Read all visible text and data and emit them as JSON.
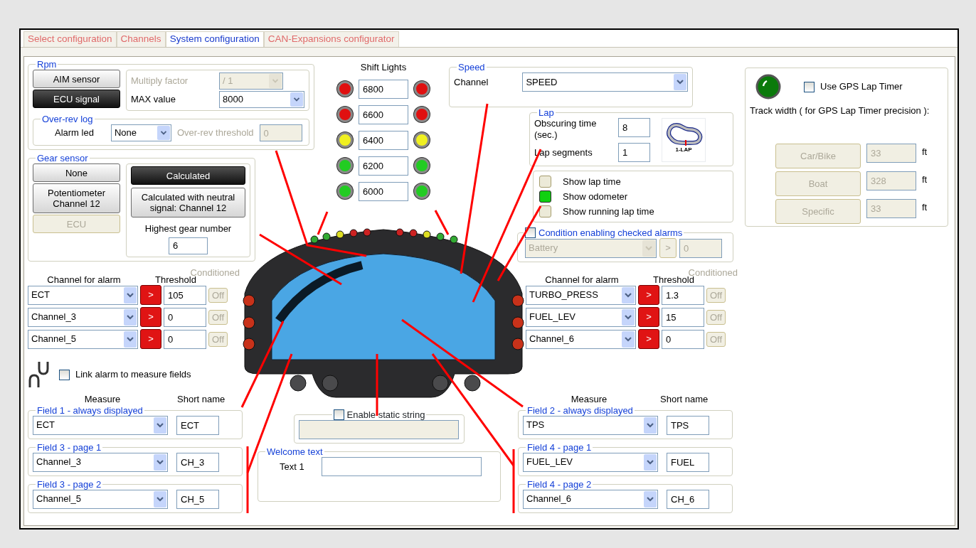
{
  "tabs": [
    {
      "label": "Select configuration",
      "selected": false
    },
    {
      "label": "Channels",
      "selected": false
    },
    {
      "label": "System configuration",
      "selected": true
    },
    {
      "label": "CAN-Expansions configurator",
      "selected": false
    }
  ],
  "rpm": {
    "title": "Rpm",
    "sources": [
      {
        "label": "AIM sensor",
        "selected": false
      },
      {
        "label": "ECU signal",
        "selected": true
      }
    ],
    "multiply_factor": {
      "label": "Multiply factor",
      "value": "/ 1",
      "disabled": true
    },
    "max_value": {
      "label": "MAX value",
      "value": "8000",
      "disabled": false
    }
  },
  "over_rev_log": {
    "title": "Over-rev log",
    "alarm_led": {
      "label": "Alarm led",
      "value": "None"
    },
    "threshold": {
      "label": "Over-rev threshold",
      "value": "0",
      "disabled": true
    }
  },
  "gear_sensor": {
    "title": "Gear sensor",
    "sources": [
      {
        "label": "None",
        "selected": false,
        "disabled": false
      },
      {
        "label": "Potentiometer Channel 12",
        "selected": false,
        "disabled": false
      },
      {
        "label": "ECU",
        "selected": false,
        "disabled": true
      }
    ],
    "modes": [
      {
        "label": "Calculated",
        "selected": true
      },
      {
        "label": "Calculated with neutral signal:  Channel 12",
        "selected": false
      }
    ],
    "highest_gear": {
      "label": "Highest gear number",
      "value": "6"
    }
  },
  "shift_lights": {
    "title": "Shift Lights",
    "rows": [
      {
        "value": "6800",
        "color": "#e01010"
      },
      {
        "value": "6600",
        "color": "#e01010"
      },
      {
        "value": "6400",
        "color": "#f0f020"
      },
      {
        "value": "6200",
        "color": "#22cc22"
      },
      {
        "value": "6000",
        "color": "#22cc22"
      }
    ]
  },
  "speed": {
    "title": "Speed",
    "channel_label": "Channel",
    "channel": "SPEED"
  },
  "lap": {
    "title": "Lap",
    "obscuring_label": "Obscuring time (sec.)",
    "obscuring_value": "8",
    "segments_label": "Lap segments",
    "segments_value": "1",
    "track_caption": "1-LAP"
  },
  "display_options": [
    {
      "label": "Show lap time",
      "checked": false
    },
    {
      "label": "Show odometer",
      "checked": true
    },
    {
      "label": "Show running lap time",
      "checked": false
    }
  ],
  "condition": {
    "label": "Condition enabling checked alarms",
    "checked": false,
    "channel": "Battery",
    "operator": ">",
    "value": "0",
    "disabled": true
  },
  "gps": {
    "use_gps": {
      "label": "Use GPS Lap Timer",
      "checked": false
    },
    "track_width_label": "Track width ( for GPS Lap Timer precision ):",
    "disabled": true,
    "presets": [
      {
        "label": "Car/Bike",
        "value": "33",
        "unit": "ft"
      },
      {
        "label": "Boat",
        "value": "328",
        "unit": "ft"
      },
      {
        "label": "Specific",
        "value": "33",
        "unit": "ft"
      }
    ]
  },
  "alarm_groups": [
    {
      "channel_header": "Channel for alarm",
      "threshold_header": "Threshold",
      "conditioned_header": "Conditioned",
      "rows": [
        {
          "channel": "ECT",
          "operator": ">",
          "threshold": "105",
          "condition": "Off"
        },
        {
          "channel": "Channel_3",
          "operator": ">",
          "threshold": "0",
          "condition": "Off"
        },
        {
          "channel": "Channel_5",
          "operator": ">",
          "threshold": "0",
          "condition": "Off"
        }
      ]
    },
    {
      "channel_header": "Channel for alarm",
      "threshold_header": "Threshold",
      "conditioned_header": "Conditioned",
      "rows": [
        {
          "channel": "TURBO_PRESS",
          "operator": ">",
          "threshold": "1.3",
          "condition": "Off"
        },
        {
          "channel": "FUEL_LEV",
          "operator": ">",
          "threshold": "15",
          "condition": "Off"
        },
        {
          "channel": "Channel_6",
          "operator": ">",
          "threshold": "0",
          "condition": "Off"
        }
      ]
    }
  ],
  "link_alarm": {
    "label": "Link alarm to measure fields",
    "checked": false
  },
  "field_groups": [
    {
      "measure_header": "Measure",
      "short_header": "Short name",
      "fields": [
        {
          "title": "Field 1 - always displayed",
          "measure": "ECT",
          "short_name": "ECT"
        },
        {
          "title": "Field 3 - page 1",
          "measure": "Channel_3",
          "short_name": "CH_3"
        },
        {
          "title": "Field 3 - page 2",
          "measure": "Channel_5",
          "short_name": "CH_5"
        }
      ]
    },
    {
      "measure_header": "Measure",
      "short_header": "Short name",
      "fields": [
        {
          "title": "Field 2 - always displayed",
          "measure": "TPS",
          "short_name": "TPS"
        },
        {
          "title": "Field 4 - page 1",
          "measure": "FUEL_LEV",
          "short_name": "FUEL"
        },
        {
          "title": "Field 4 - page 2",
          "measure": "Channel_6",
          "short_name": "CH_6"
        }
      ]
    }
  ],
  "static_string": {
    "label": "Enable static string",
    "checked": false
  },
  "welcome": {
    "title": "Welcome text",
    "label": "Text 1"
  }
}
